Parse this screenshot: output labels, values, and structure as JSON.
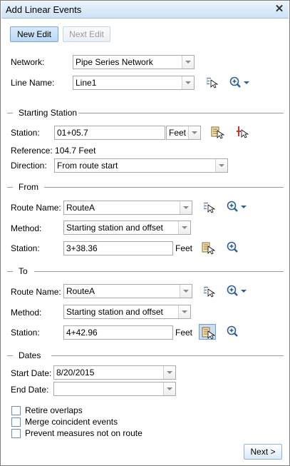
{
  "window": {
    "title": "Add Linear Events"
  },
  "toolbar": {
    "new_edit": "New Edit",
    "next_edit": "Next Edit"
  },
  "network": {
    "label": "Network:",
    "value": "Pipe Series Network"
  },
  "line_name": {
    "label": "Line Name:",
    "value": "Line1"
  },
  "starting_station": {
    "header": "Starting Station",
    "station_label": "Station:",
    "station_value": "01+05.7",
    "units": "Feet",
    "reference": "Reference: 104.7 Feet",
    "direction_label": "Direction:",
    "direction_value": "From route start"
  },
  "from": {
    "header": "From",
    "route_label": "Route Name:",
    "route_value": "RouteA",
    "method_label": "Method:",
    "method_value": "Starting station and offset",
    "station_label": "Station:",
    "station_value": "3+38.36",
    "units": "Feet"
  },
  "to": {
    "header": "To",
    "route_label": "Route Name:",
    "route_value": "RouteA",
    "method_label": "Method:",
    "method_value": "Starting station and offset",
    "station_label": "Station:",
    "station_value": "4+42.96",
    "units": "Feet"
  },
  "dates": {
    "header": "Dates",
    "start_label": "Start Date:",
    "start_value": "8/20/2015",
    "end_label": "End Date:",
    "end_value": ""
  },
  "options": [
    {
      "label": "Retire overlaps",
      "checked": false
    },
    {
      "label": "Merge coincident events",
      "checked": false
    },
    {
      "label": "Prevent measures not on route",
      "checked": false
    }
  ],
  "footer": {
    "next": "Next >"
  },
  "colors": {
    "accent": "#1f5fbf",
    "title_bar": "#d6e6f6",
    "border": "#7f7f7f"
  }
}
